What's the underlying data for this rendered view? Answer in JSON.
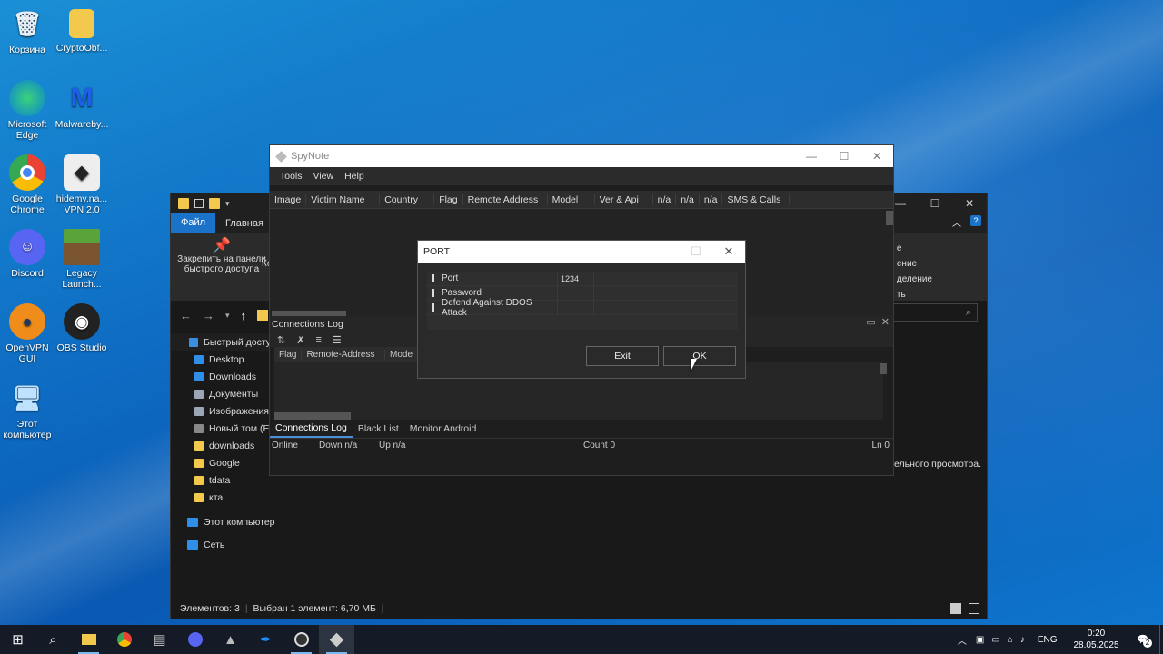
{
  "desktop": {
    "icons": [
      {
        "label": "Корзина",
        "icon": "recycle-bin-icon"
      },
      {
        "label": "CryptoObf...",
        "icon": "folder-icon"
      },
      {
        "label": "Microsoft Edge",
        "icon": "edge-icon"
      },
      {
        "label": "Malwareby...",
        "icon": "malwarebytes-icon"
      },
      {
        "label": "Google Chrome",
        "icon": "chrome-icon"
      },
      {
        "label": "hidemy.na... VPN 2.0",
        "icon": "vpn-icon"
      },
      {
        "label": "Discord",
        "icon": "discord-icon"
      },
      {
        "label": "Legacy Launch...",
        "icon": "minecraft-icon"
      },
      {
        "label": "OpenVPN GUI",
        "icon": "openvpn-icon"
      },
      {
        "label": "OBS Studio",
        "icon": "obs-icon"
      },
      {
        "label": "Этот компьютер",
        "icon": "computer-icon"
      }
    ]
  },
  "explorer": {
    "ribbon_tabs": [
      "Файл",
      "Главная"
    ],
    "pin_label": "Закрепить на панели быстрого доступа",
    "pin_label_cut": "Ко",
    "ribbon_right": [
      "е",
      "ение",
      "деление",
      "ть"
    ],
    "nav_items": [
      {
        "label": "Быстрый доступ",
        "color": "#3a8fe0"
      },
      {
        "label": "Desktop",
        "color": "#2f8fe8"
      },
      {
        "label": "Downloads",
        "color": "#2f8fe8"
      },
      {
        "label": "Документы",
        "color": "#9aa5b5"
      },
      {
        "label": "Изображения",
        "color": "#9aa5b5"
      },
      {
        "label": "Новый том (E:)",
        "color": "#888888"
      },
      {
        "label": "downloads",
        "color": "#f2c94c"
      },
      {
        "label": "Google",
        "color": "#f2c94c"
      },
      {
        "label": "tdata",
        "color": "#f2c94c"
      },
      {
        "label": "кта",
        "color": "#f2c94c"
      },
      {
        "label": "Этот компьютер",
        "color": "#2f8fe8"
      },
      {
        "label": "Сеть",
        "color": "#2f8fe8"
      }
    ],
    "preview_text": "ительного просмотра.",
    "status": {
      "count": "Элементов: 3",
      "selected": "Выбран 1 элемент: 6,70 МБ"
    }
  },
  "spynote": {
    "title": "SpyNote",
    "menu": [
      "Tools",
      "View",
      "Help"
    ],
    "columns": [
      "Image",
      "Victim Name",
      "Country",
      "Flag",
      "Remote Address",
      "Model",
      "Ver & Api",
      "n/a",
      "n/a",
      "n/a",
      "SMS & Calls"
    ],
    "connections_log": {
      "title": "Connections Log",
      "columns": [
        "Flag",
        "Remote-Address",
        "Mode"
      ]
    },
    "tabs": [
      "Connections Log",
      "Black List",
      "Monitor Android"
    ],
    "status": {
      "online": "Online",
      "down": "Down n/a",
      "up": "Up n/a",
      "count": "Count 0",
      "ln": "Ln 0"
    }
  },
  "port_dialog": {
    "title": "PORT",
    "rows": [
      {
        "label": "Port",
        "value": "1234"
      },
      {
        "label": "Password",
        "value": ""
      },
      {
        "label": "Defend Against DDOS Attack",
        "value": ""
      }
    ],
    "exit_label": "Exit",
    "ok_label": "OK"
  },
  "taskbar": {
    "lang": "ENG",
    "time": "0:20",
    "date": "28.05.2025",
    "notifications": "2"
  }
}
